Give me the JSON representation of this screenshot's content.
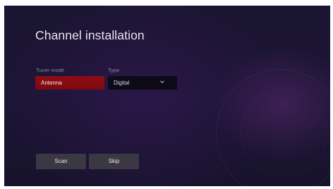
{
  "page": {
    "title": "Channel installation"
  },
  "tuner_mode": {
    "label": "Tuner mode",
    "value": "Antenna"
  },
  "type": {
    "label": "Type",
    "value": "Digital",
    "icon": "chevron-down-icon"
  },
  "buttons": {
    "scan": "Scan",
    "skip": "Skip"
  },
  "colors": {
    "background": "#1a1530",
    "selected": "#8e0d12",
    "button": "#3a3843"
  }
}
